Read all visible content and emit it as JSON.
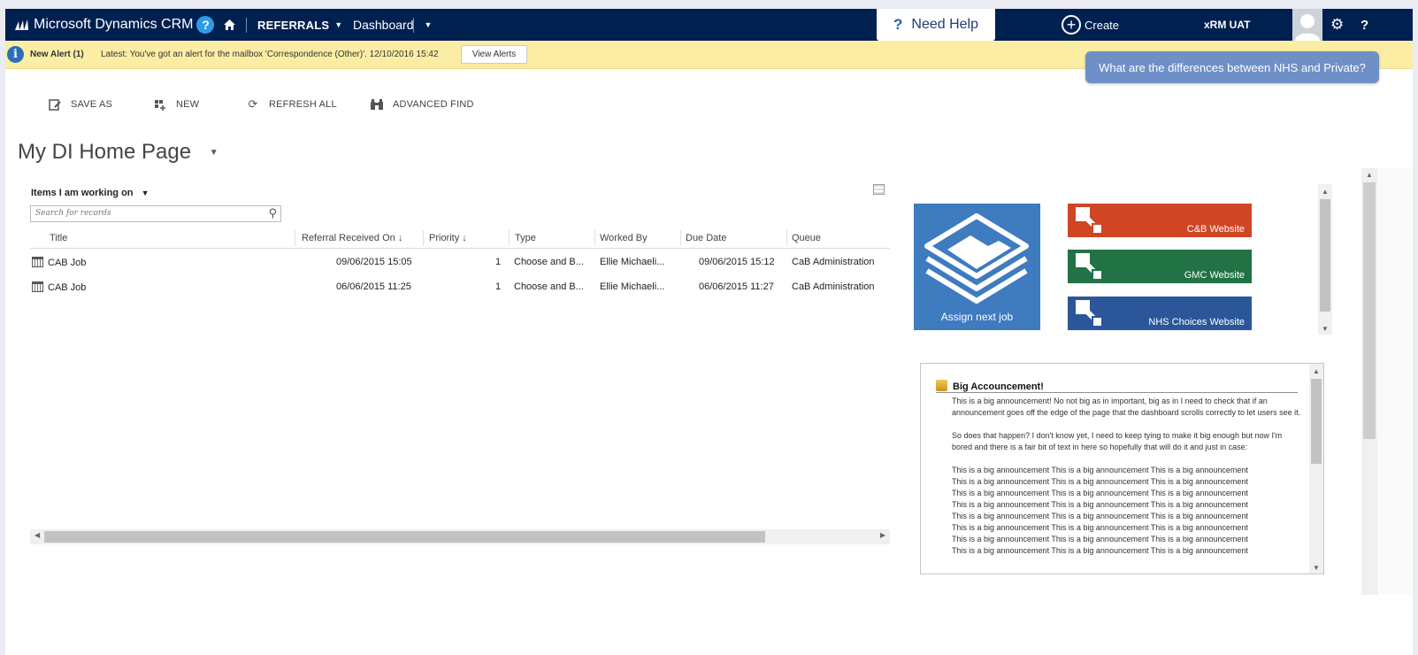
{
  "nav": {
    "brand": "Microsoft Dynamics CRM",
    "help_badge": "?",
    "area": "REFERRALS",
    "dashboard": "Dashboard",
    "need_help": "Need Help",
    "create": "Create",
    "org": "xRM UAT",
    "help_q": "?"
  },
  "alert": {
    "icon": "i",
    "title": "New Alert (1)",
    "message": "Latest: You've got an alert for the mailbox 'Correspondence (Other)'. 12/10/2016 15:42",
    "button": "View Alerts"
  },
  "tooltip": "What are the differences between NHS and Private?",
  "commands": {
    "save_as": "SAVE AS",
    "new": "NEW",
    "refresh_all": "REFRESH ALL",
    "advanced_find": "ADVANCED FIND"
  },
  "page_title": "My DI Home Page",
  "view": {
    "title": "Items I am working on",
    "search_placeholder": "Search for records",
    "columns": [
      "Title",
      "Referral Received On ↓",
      "Priority ↓",
      "Type",
      "Worked By",
      "Due Date",
      "Queue"
    ],
    "rows": [
      [
        "CAB Job",
        "09/06/2015 15:05",
        "1",
        "Choose and B...",
        "Ellie Michaeli...",
        "09/06/2015 15:12",
        "CaB Administration"
      ],
      [
        "CAB Job",
        "06/06/2015 11:25",
        "1",
        "Choose and B...",
        "Ellie Michaeli...",
        "06/06/2015 11:27",
        "CaB Administration"
      ]
    ]
  },
  "tiles": {
    "assign": "Assign next job",
    "links": [
      {
        "label": "C&B Website",
        "color": "#d04524"
      },
      {
        "label": "GMC Website",
        "color": "#217346"
      },
      {
        "label": "NHS Choices Website",
        "color": "#2b579a"
      }
    ]
  },
  "announcement": {
    "title": "Big Accouncement!",
    "paragraphs": [
      "This is a big announcement! No not big as in important, big as in I need to check that if an announcement goes off the edge of the page that the dashboard scrolls correctly to let users see it.",
      "So does that happen? I don't know yet, I need to keep tying to make it big enough but now I'm bored and there is a fair bit of text in here so hopefully that will do it and just in case:"
    ],
    "repeat_line": "This is a big announcement This is a big announcement This is a big announcement",
    "repeat_count": 8
  }
}
